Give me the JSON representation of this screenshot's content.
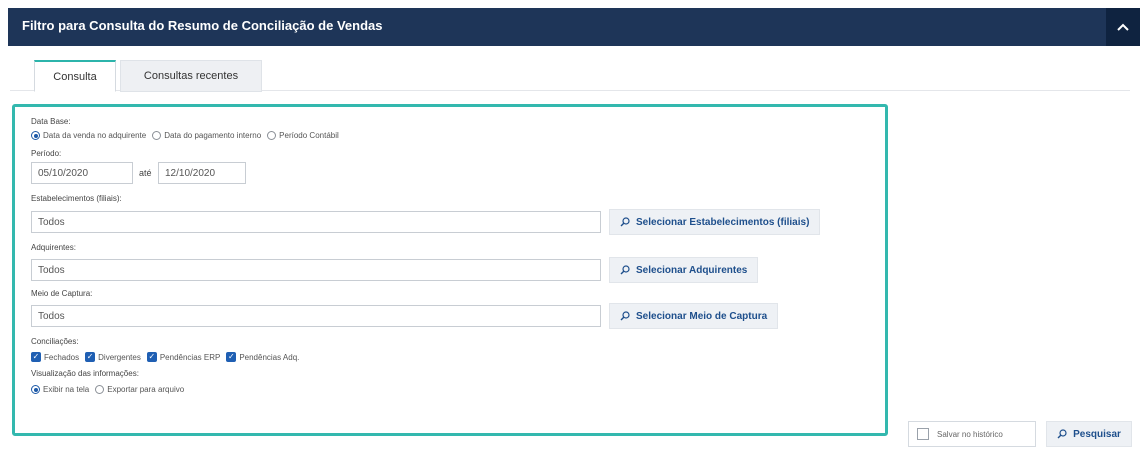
{
  "header": {
    "title": "Filtro para Consulta do Resumo de Conciliação de Vendas"
  },
  "tabs": [
    {
      "label": "Consulta",
      "active": true
    },
    {
      "label": "Consultas recentes",
      "active": false
    }
  ],
  "form": {
    "data_base": {
      "label": "Data Base:",
      "options": [
        {
          "label": "Data da venda no adquirente",
          "selected": true
        },
        {
          "label": "Data do pagamento interno",
          "selected": false
        },
        {
          "label": "Período Contábil",
          "selected": false
        }
      ]
    },
    "periodo": {
      "label": "Período:",
      "start": "05/10/2020",
      "separator": "até",
      "end": "12/10/2020"
    },
    "estabelecimentos": {
      "label": "Estabelecimentos (filiais):",
      "value": "Todos",
      "button_label": "Selecionar Estabelecimentos (filiais)"
    },
    "adquirentes": {
      "label": "Adquirentes:",
      "value": "Todos",
      "button_label": "Selecionar Adquirentes"
    },
    "meio_captura": {
      "label": "Meio de Captura:",
      "value": "Todos",
      "button_label": "Selecionar Meio de Captura"
    },
    "conciliacoes": {
      "label": "Conciliações:",
      "options": [
        {
          "label": "Fechados",
          "checked": true
        },
        {
          "label": "Divergentes",
          "checked": true
        },
        {
          "label": "Pendências ERP",
          "checked": true
        },
        {
          "label": "Pendências Adq.",
          "checked": true
        }
      ]
    },
    "visualizacao": {
      "label": "Visualização das informações:",
      "options": [
        {
          "label": "Exibir na tela",
          "selected": true
        },
        {
          "label": "Exportar para arquivo",
          "selected": false
        }
      ]
    }
  },
  "actions": {
    "save_history_label": "Salvar no histórico",
    "search_label": "Pesquisar"
  },
  "colors": {
    "header_bg": "#1e3558",
    "accent": "#33b8ae",
    "link": "#1e4f8c",
    "checkbox": "#1f5fb3"
  }
}
